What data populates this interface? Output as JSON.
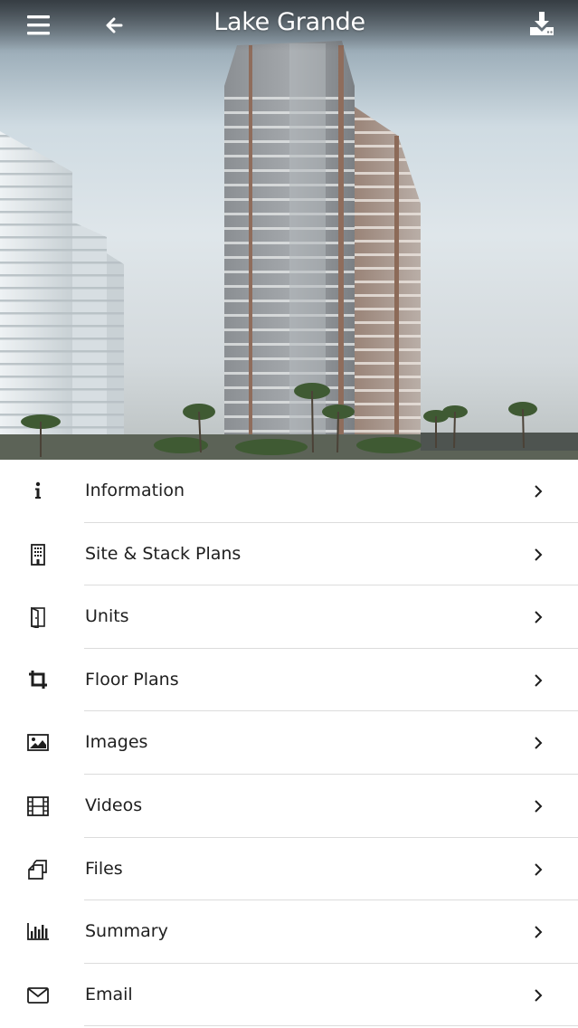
{
  "header": {
    "title": "Lake Grande",
    "menu_icon": "hamburger-menu-icon",
    "back_icon": "arrow-left-icon",
    "download_icon": "download-icon"
  },
  "hero": {
    "image_subject": "condominium-tower-rendering"
  },
  "menu": {
    "items": [
      {
        "label": "Information",
        "icon": "info-icon"
      },
      {
        "label": "Site & Stack Plans",
        "icon": "building-icon"
      },
      {
        "label": "Units",
        "icon": "door-icon"
      },
      {
        "label": "Floor Plans",
        "icon": "crop-icon"
      },
      {
        "label": "Images",
        "icon": "image-icon"
      },
      {
        "label": "Videos",
        "icon": "film-icon"
      },
      {
        "label": "Files",
        "icon": "files-icon"
      },
      {
        "label": "Summary",
        "icon": "bar-chart-icon"
      },
      {
        "label": "Email",
        "icon": "envelope-icon"
      }
    ]
  },
  "colors": {
    "title_text": "#ffffff",
    "list_text": "#202020",
    "divider": "#dcdcdc",
    "icon": "#1e1e1e"
  }
}
